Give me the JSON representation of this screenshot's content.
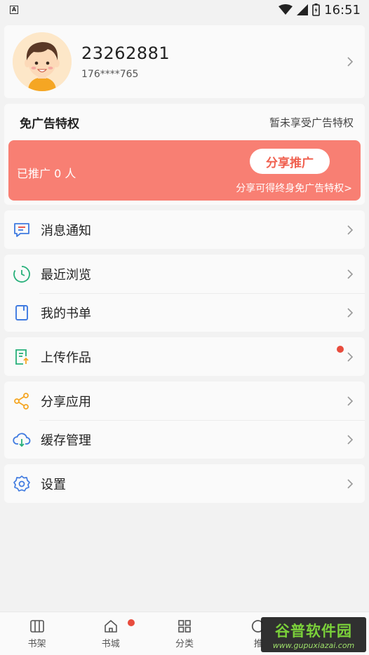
{
  "statusbar": {
    "time": "16:51",
    "notification_icon": "A"
  },
  "profile": {
    "user_id": "23262881",
    "phone": "176****765"
  },
  "ad_privilege": {
    "title": "免广告特权",
    "status": "暂未享受广告特权",
    "promoted_count": "已推广 0 人",
    "share_button": "分享推广",
    "tip": "分享可得终身免广告特权>"
  },
  "menu": {
    "notifications": "消息通知",
    "recent": "最近浏览",
    "booklist": "我的书单",
    "upload": "上传作品",
    "share_app": "分享应用",
    "cache": "缓存管理",
    "settings": "设置"
  },
  "tabbar": {
    "bookshelf": "书架",
    "bookstore": "书城",
    "category": "分类",
    "recommend": "推"
  },
  "watermark": {
    "title": "谷普软件园",
    "url": "www.gupuxiazai.com"
  },
  "colors": {
    "accent": "#f87f73",
    "badge": "#e84c3d",
    "share_text": "#f0604f"
  }
}
